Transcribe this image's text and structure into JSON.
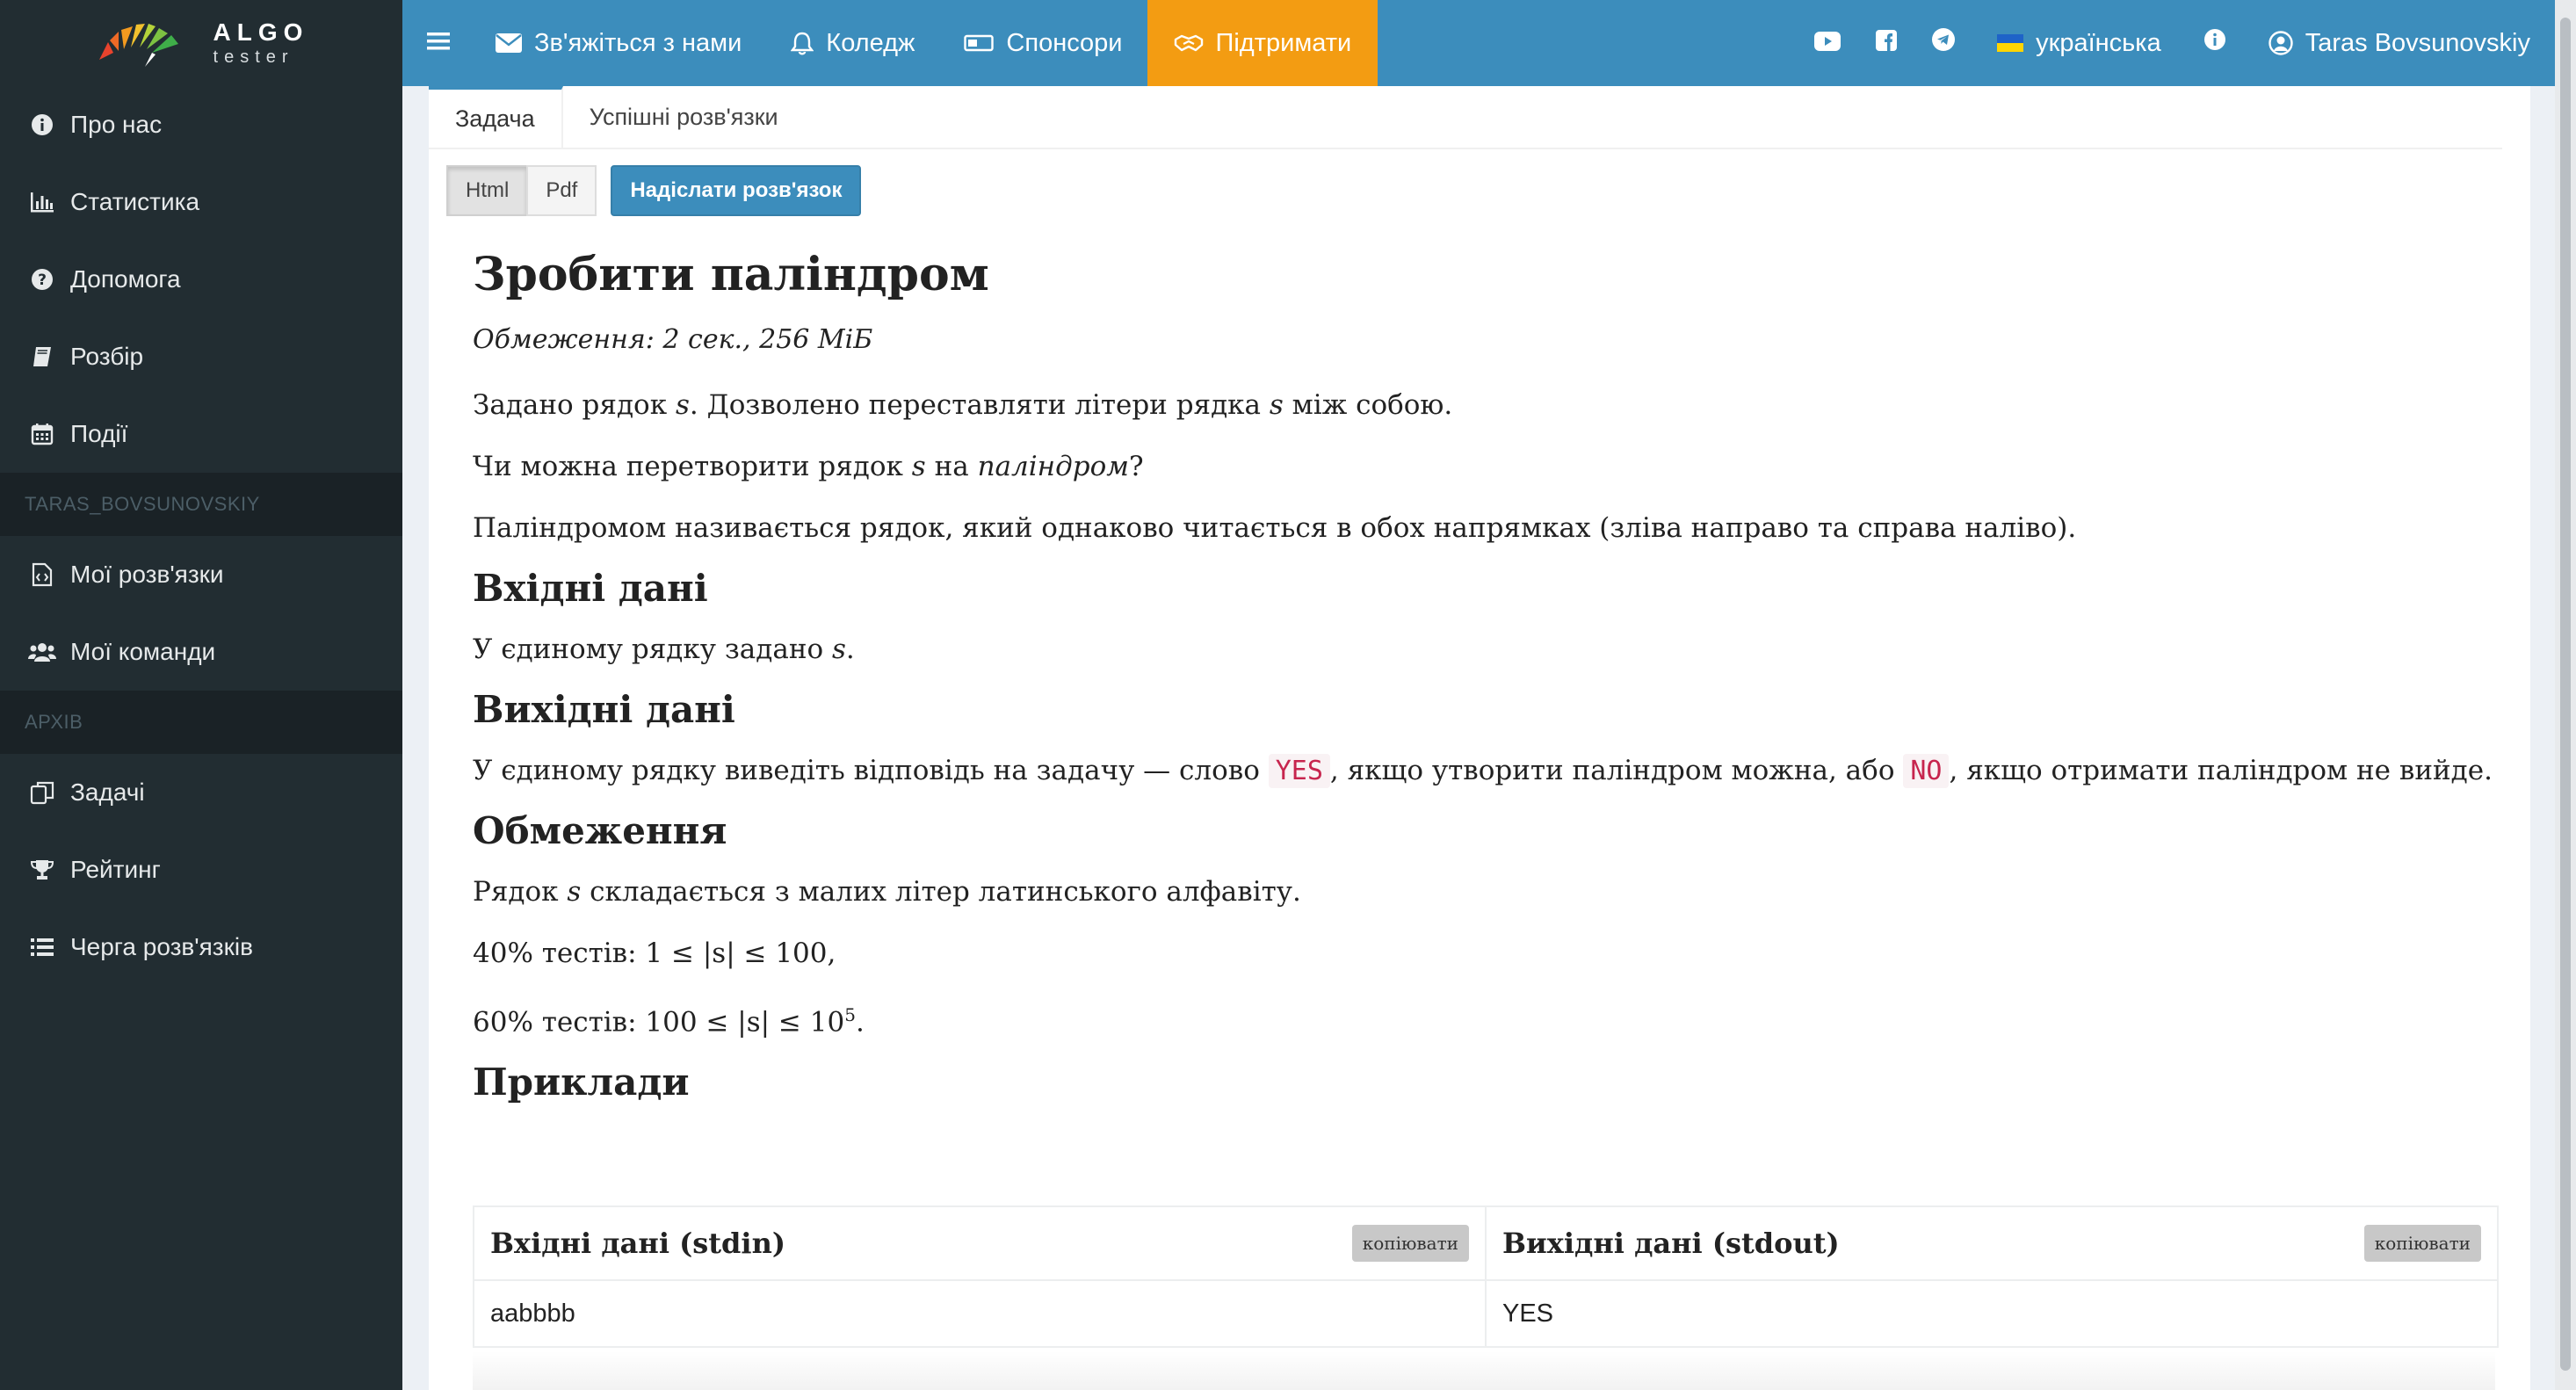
{
  "logo": {
    "main": "ALGO",
    "sub": "tester"
  },
  "sidebar": {
    "items_top": [
      {
        "label": "Про нас",
        "icon": "info-circle-icon"
      },
      {
        "label": "Статистика",
        "icon": "bar-chart-icon"
      },
      {
        "label": "Допомога",
        "icon": "question-circle-icon"
      },
      {
        "label": "Розбір",
        "icon": "book-icon"
      },
      {
        "label": "Події",
        "icon": "calendar-icon"
      }
    ],
    "section_user": "TARAS_BOVSUNOVSKIY",
    "items_user": [
      {
        "label": "Мої розв'язки",
        "icon": "file-code-icon"
      },
      {
        "label": "Мої команди",
        "icon": "users-icon"
      }
    ],
    "section_archive": "АРХІВ",
    "items_archive": [
      {
        "label": "Задачі",
        "icon": "copy-icon"
      },
      {
        "label": "Рейтинг",
        "icon": "trophy-icon"
      },
      {
        "label": "Черга розв'язків",
        "icon": "list-icon"
      }
    ]
  },
  "topbar": {
    "contact": "Зв'яжіться з нами",
    "college": "Коледж",
    "sponsors": "Спонсори",
    "support": "Підтримати",
    "language": "українська",
    "user": "Taras Bovsunovskiy"
  },
  "tabs": {
    "problem": "Задача",
    "accepted": "Успішні розв'язки"
  },
  "buttons": {
    "html": "Html",
    "pdf": "Pdf",
    "submit": "Надіслати розв'язок"
  },
  "problem": {
    "title": "Зробити паліндром",
    "limits": "Обмеження: 2 сек., 256 МіБ",
    "var_s": "s",
    "p1_a": "Задано рядок ",
    "p1_b": ". Дозволено переставляти літери рядка ",
    "p1_c": " між собою.",
    "p2_a": "Чи можна перетворити рядок ",
    "p2_b": " на ",
    "p2_em": "паліндром",
    "p2_c": "?",
    "p3": "Паліндромом називається рядок, який однаково читається в обох напрямках (зліва направо та справа наліво).",
    "input_heading": "Вхідні дані",
    "input_a": "У єдиному рядку задано ",
    "input_b": ".",
    "output_heading": "Вихідні дані",
    "output_a": "У єдиному рядку виведіть відповідь на задачу — слово ",
    "yes": "YES",
    "output_b": ", якщо утворити паліндром можна, або ",
    "no": "NO",
    "output_c": ", якщо отримати паліндром не вийде.",
    "constraints_heading": "Обмеження",
    "c1_a": "Рядок ",
    "c1_b": " складається з малих літер латинського алфавіту.",
    "c2": "40% тестів: 1 ≤ |s| ≤ 100,",
    "c3_a": "60% тестів: 100 ≤ |s| ≤ 10",
    "c3_sup": "5",
    "c3_b": ".",
    "examples_heading": "Приклади"
  },
  "samples": {
    "input_header": "Вхідні дані (stdin)",
    "output_header": "Вихідні дані (stdout)",
    "copy_label": "копіювати",
    "input_value": "aabbbb",
    "output_value": "YES"
  },
  "colors": {
    "sidebar_bg": "#222d32",
    "topbar_bg": "#3c8dbc",
    "support_bg": "#f39c12",
    "code_fg": "#c7254e"
  }
}
